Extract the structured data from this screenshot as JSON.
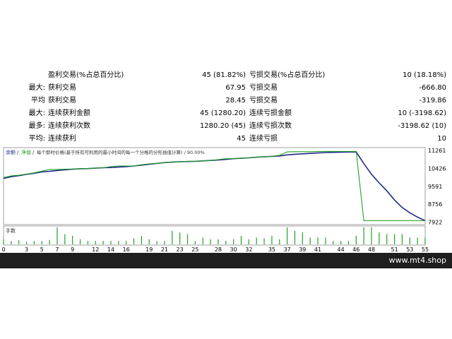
{
  "stats": {
    "rows": [
      {
        "label": "",
        "name": "盈利交易(%占总百分比)",
        "value": "45 (81.82%)",
        "name2": "亏损交易(%占总百分比)",
        "value2": "10 (18.18%)"
      },
      {
        "label": "最大:",
        "name": "获利交易",
        "value": "67.95",
        "name2": "亏损交易",
        "value2": "-666.80"
      },
      {
        "label": "平均",
        "name": "获利交易",
        "value": "28.45",
        "name2": "亏损交易",
        "value2": "-319.86"
      },
      {
        "label": "最大:",
        "name": "连续获利金额",
        "value": "45 (1280.20)",
        "name2": "连续亏损金额",
        "value2": "10 (-3198.62)"
      },
      {
        "label": "最多:",
        "name": "连续获利次数",
        "value": "1280.20 (45)",
        "name2": "连续亏损次数",
        "value2": "-3198.62 (10)"
      },
      {
        "label": "平均:",
        "name": "连续获利",
        "value": "45",
        "name2": "连续亏损",
        "value2": "10"
      }
    ]
  },
  "chart_data": {
    "type": "line",
    "legend": {
      "balance": "余额",
      "equity": "净值",
      "note": "每个即时价格(基于所有可利用的最小时间的每一个分格的分形插值计算) / 90.00%"
    },
    "x": [
      0,
      1,
      2,
      3,
      4,
      5,
      6,
      7,
      8,
      9,
      10,
      11,
      12,
      13,
      14,
      15,
      16,
      17,
      18,
      19,
      20,
      21,
      22,
      23,
      24,
      25,
      26,
      27,
      28,
      29,
      30,
      31,
      32,
      33,
      34,
      35,
      36,
      37,
      38,
      39,
      40,
      41,
      42,
      43,
      44,
      45,
      46,
      47,
      48,
      49,
      50,
      51,
      52,
      53,
      54,
      55
    ],
    "series": [
      {
        "key": "balance",
        "color": "#1f2a8a",
        "values": [
          9960,
          10040,
          10090,
          10150,
          10200,
          10260,
          10290,
          10330,
          10360,
          10390,
          10410,
          10420,
          10440,
          10460,
          10470,
          10490,
          10510,
          10540,
          10580,
          10620,
          10660,
          10700,
          10720,
          10740,
          10750,
          10760,
          10780,
          10800,
          10820,
          10850,
          10880,
          10900,
          10920,
          10950,
          10970,
          10990,
          11010,
          11060,
          11090,
          11110,
          11130,
          11150,
          11170,
          11180,
          11190,
          11195,
          11200,
          10650,
          10150,
          9750,
          9380,
          8950,
          8600,
          8350,
          8150,
          7980
        ]
      },
      {
        "key": "equity",
        "color": "#22a022",
        "values": [
          10000,
          10080,
          10110,
          10160,
          10220,
          10300,
          10380,
          10380,
          10390,
          10400,
          10420,
          10420,
          10440,
          10460,
          10510,
          10540,
          10540,
          10540,
          10600,
          10640,
          10660,
          10700,
          10730,
          10730,
          10760,
          10760,
          10780,
          10800,
          10840,
          10880,
          10880,
          10900,
          10920,
          10950,
          10980,
          10990,
          11040,
          11200,
          11210,
          11210,
          11210,
          11220,
          11220,
          11220,
          11220,
          11220,
          11220,
          7980,
          7980,
          7980,
          7980,
          7980,
          7980,
          7980,
          7980,
          7980
        ]
      }
    ],
    "volume": [
      1.5,
      1,
      1.2,
      0.8,
      1,
      1,
      1.3,
      5,
      3,
      2.5,
      1.5,
      1,
      1,
      1,
      1,
      1,
      1,
      1.8,
      2.5,
      1.5,
      1,
      1,
      4,
      3.5,
      3,
      1,
      2,
      1.5,
      1.5,
      1,
      1.5,
      2.5,
      1.5,
      2,
      1.8,
      2.5,
      1.5,
      5,
      4,
      3.5,
      2,
      2,
      2,
      1,
      1,
      1,
      2.5,
      5,
      5,
      3.5,
      3,
      3,
      3,
      2,
      2,
      2
    ],
    "yticks": [
      11261,
      10426,
      9591,
      8756,
      7922
    ],
    "ylim": [
      7800,
      11400
    ],
    "xticks": [
      0,
      3,
      5,
      7,
      9,
      12,
      14,
      16,
      19,
      21,
      23,
      25,
      28,
      30,
      32,
      35,
      37,
      39,
      41,
      44,
      46,
      48,
      51,
      53,
      55
    ],
    "volume_label": "手数",
    "grid": false
  },
  "footer": {
    "site": "www.mt4.shop"
  }
}
